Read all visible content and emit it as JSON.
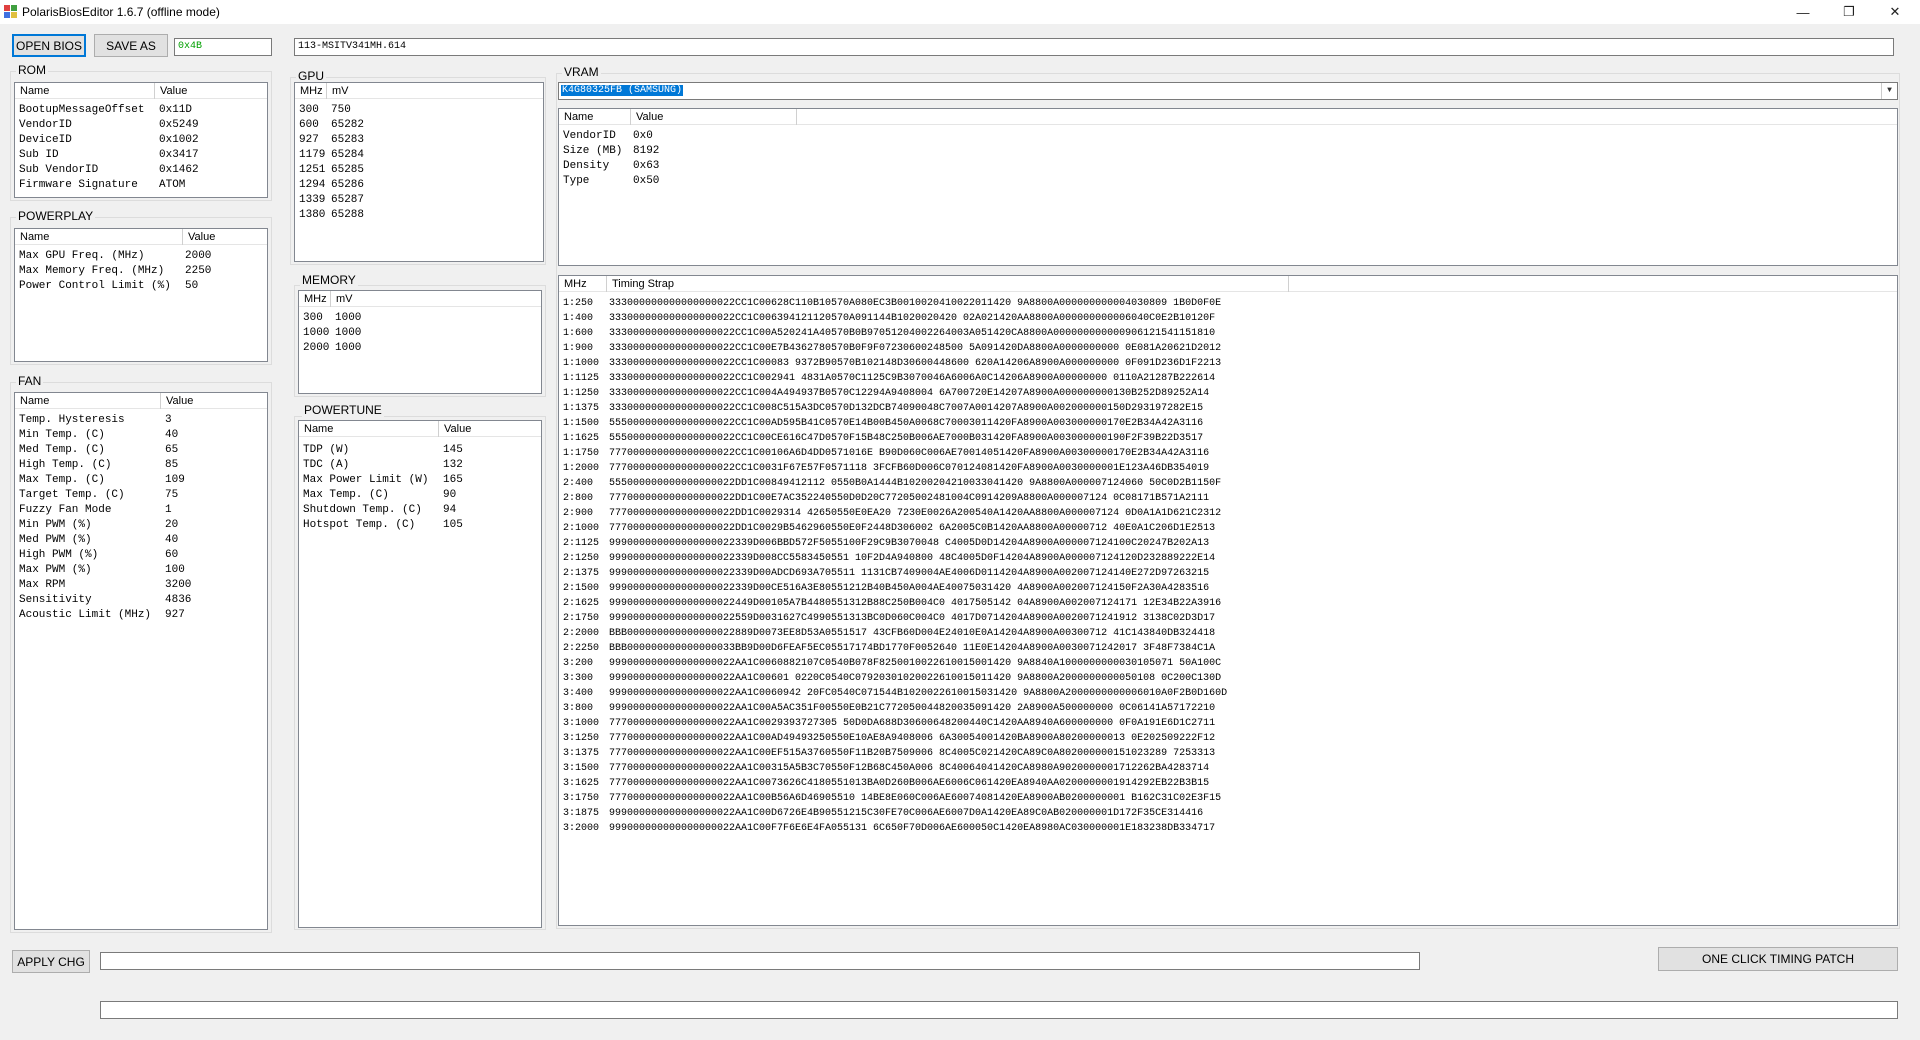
{
  "window": {
    "title": "PolarisBiosEditor 1.6.7 (offline mode)",
    "minimize_glyph": "—",
    "restore_glyph": "❐",
    "close_glyph": "✕"
  },
  "toolbar": {
    "open_label": "OPEN BIOS",
    "save_label": "SAVE AS",
    "checksum": "0x4B",
    "bios_name": "113-MSITV341MH.614"
  },
  "rom": {
    "label": "ROM",
    "headers": [
      "Name",
      "Value"
    ],
    "rows": [
      [
        "BootupMessageOffset",
        "0x11D"
      ],
      [
        "VendorID",
        "0x5249"
      ],
      [
        "DeviceID",
        "0x1002"
      ],
      [
        "Sub ID",
        "0x3417"
      ],
      [
        "Sub VendorID",
        "0x1462"
      ],
      [
        "Firmware Signature",
        "ATOM"
      ]
    ]
  },
  "powerplay": {
    "label": "POWERPLAY",
    "headers": [
      "Name",
      "Value"
    ],
    "rows": [
      [
        "Max GPU Freq. (MHz)",
        "2000"
      ],
      [
        "Max Memory Freq. (MHz)",
        "2250"
      ],
      [
        "Power Control Limit (%)",
        "50"
      ]
    ]
  },
  "fan": {
    "label": "FAN",
    "headers": [
      "Name",
      "Value"
    ],
    "rows": [
      [
        "Temp. Hysteresis",
        "3"
      ],
      [
        "Min Temp. (C)",
        "40"
      ],
      [
        "Med Temp. (C)",
        "65"
      ],
      [
        "High Temp. (C)",
        "85"
      ],
      [
        "Max Temp. (C)",
        "109"
      ],
      [
        "Target Temp. (C)",
        "75"
      ],
      [
        "Fuzzy Fan Mode",
        "1"
      ],
      [
        "Min PWM (%)",
        "20"
      ],
      [
        "Med PWM (%)",
        "40"
      ],
      [
        "High PWM (%)",
        "60"
      ],
      [
        "Max PWM (%)",
        "100"
      ],
      [
        "Max RPM",
        "3200"
      ],
      [
        "Sensitivity",
        "4836"
      ],
      [
        "Acoustic Limit (MHz)",
        "927"
      ]
    ]
  },
  "gpu": {
    "label": "GPU",
    "headers": [
      "MHz",
      "mV"
    ],
    "rows": [
      [
        "300",
        "750"
      ],
      [
        "600",
        "65282"
      ],
      [
        "927",
        "65283"
      ],
      [
        "1179",
        "65284"
      ],
      [
        "1251",
        "65285"
      ],
      [
        "1294",
        "65286"
      ],
      [
        "1339",
        "65287"
      ],
      [
        "1380",
        "65288"
      ]
    ]
  },
  "memory": {
    "label": "MEMORY",
    "headers": [
      "MHz",
      "mV"
    ],
    "rows": [
      [
        "300",
        "1000"
      ],
      [
        "1000",
        "1000"
      ],
      [
        "2000",
        "1000"
      ]
    ]
  },
  "powertune": {
    "label": "POWERTUNE",
    "headers": [
      "Name",
      "Value"
    ],
    "rows": [
      [
        "TDP (W)",
        "145"
      ],
      [
        "TDC (A)",
        "132"
      ],
      [
        "Max Power Limit (W)",
        "165"
      ],
      [
        "Max Temp. (C)",
        "90"
      ],
      [
        "Shutdown Temp. (C)",
        "94"
      ],
      [
        "Hotspot Temp. (C)",
        "105"
      ]
    ]
  },
  "vram": {
    "label": "VRAM",
    "selected": "K4G80325FB (SAMSUNG)",
    "headers": [
      "Name",
      "Value"
    ],
    "rows": [
      [
        "VendorID",
        "0x0"
      ],
      [
        "Size (MB)",
        "8192"
      ],
      [
        "Density",
        "0x63"
      ],
      [
        "Type",
        "0x50"
      ]
    ]
  },
  "timings": {
    "headers": [
      "MHz",
      "Timing Strap"
    ],
    "rows": [
      [
        "1:250",
        "333000000000000000022CC1C00628C110B10570A080EC3B0010020410022011420 9A8800A000000000004030809 1B0D0F0E"
      ],
      [
        "1:400",
        "333000000000000000022CC1C006394121120570A091144B1020020420 02A021420AA8800A000000000006040C0E2B10120F"
      ],
      [
        "1:600",
        "333000000000000000022CC1C00A520241A40570B0B97051204002264003A051420CA8800A000000000000906121541151810"
      ],
      [
        "1:900",
        "333000000000000000022CC1C00E7B4362780570B0F9F07230600248500 5A091420DA8800A0000000000 0E081A20621D2012"
      ],
      [
        "1:1000",
        "333000000000000000022CC1C00083 9372B90570B102148D30600448600 620A14206A8900A000000000 0F091D236D1F2213"
      ],
      [
        "1:1125",
        "333000000000000000022CC1C002941 4831A0570C1125C9B3070046A6006A0C14206A8900A00000000 0110A21287B222614"
      ],
      [
        "1:1250",
        "333000000000000000022CC1C004A494937B0570C12294A9408004 6A700720E14207A8900A000000000130B252D89252A14"
      ],
      [
        "1:1375",
        "333000000000000000022CC1C008C515A3DC0570D132DCB74090048C7007A0014207A8900A002000000150D293197282E15"
      ],
      [
        "1:1500",
        "555000000000000000022CC1C00AD595B41C0570E14B00B450A0068C70003011420FA8900A003000000170E2B34A42A3116"
      ],
      [
        "1:1625",
        "555000000000000000022CC1C00CE616C47D0570F15B48C250B006AE7000B031420FA8900A003000000190F2F39B22D3517"
      ],
      [
        "1:1750",
        "777000000000000000022CC1C00106A6D4DD0571016E B90D060C006AE70014051420FA8900A00300000170E2B34A42A3116"
      ],
      [
        "1:2000",
        "777000000000000000022CC1C0031F67E57F0571118 3FCFB60D006C070124081420FA8900A0030000001E123A46DB354019"
      ],
      [
        "2:400",
        "555000000000000000022DD1C00849412112 0550B0A1444B10200204210033041420 9A8800A000007124060 50C0D2B1150F"
      ],
      [
        "2:800",
        "777000000000000000022DD1C00E7AC352240550D0D20C77205002481004C0914209A8800A000007124 0C08171B571A2111"
      ],
      [
        "2:900",
        "777000000000000000022DD1C0029314 42650550E0EA20 7230E0026A200540A1420AA8800A000007124 0D0A1A1D621C2312"
      ],
      [
        "2:1000",
        "777000000000000000022DD1C0029B5462960550E0F2448D306002 6A2005C0B1420AA8800A00000712 40E0A1C206D1E2513"
      ],
      [
        "2:1125",
        "999000000000000000022339D006BBD572F5055100F29C9B3070048 C4005D0D14204A8900A000007124100C20247B202A13"
      ],
      [
        "2:1250",
        "999000000000000000022339D008CC5583450551 10F2D4A940800 48C4005D0F14204A8900A000007124120D232889222E14"
      ],
      [
        "2:1375",
        "999000000000000000022339D00ADCD693A705511 1131CB7409004AE4006D0114204A8900A002007124140E272D97263215"
      ],
      [
        "2:1500",
        "999000000000000000022339D00CE516A3E80551212B40B450A004AE40075031420 4A8900A002007124150F2A30A4283516"
      ],
      [
        "2:1625",
        "999000000000000000022449D00105A7B4480551312B88C250B004C0 4017505142 04A8900A002007124171 12E34B22A3916"
      ],
      [
        "2:1750",
        "999000000000000000022559D0031627C4990551313BC0D060C004C0 4017D0714204A8900A0020071241912 3138C02D3D17"
      ],
      [
        "2:2000",
        "BBB000000000000000022889D0073EE8D53A0551517 43CFB60D004E24010E0A14204A8900A00300712 41C143840DB324418"
      ],
      [
        "2:2250",
        "BBB000000000000000033BB9D00D6FEAF5EC05517174BD1770F0052640 11E0E14204A8900A0030071242017 3F48F7384C1A"
      ],
      [
        "3:200",
        "999000000000000000022AA1C0060882107C0540B078F8250010022610015001420 9A8840A1000000000030105071 50A100C"
      ],
      [
        "3:300",
        "999000000000000000022AA1C00601 0220C0540C07920301020022610015011420 9A8800A2000000000050108 0C200C130D"
      ],
      [
        "3:400",
        "999000000000000000022AA1C0060942 20FC0540C071544B1020022610015031420 9A8800A2000000000006010A0F2B0D160D"
      ],
      [
        "3:800",
        "999000000000000000022AA1C00A5AC351F00550E0B21C772050044820035091420 2A8900A500000000 0C06141A57172210"
      ],
      [
        "3:1000",
        "777000000000000000022AA1C0029393727305 50D0DA688D30600648200440C1420AA8940A600000000 0F0A191E6D1C2711"
      ],
      [
        "3:1250",
        "777000000000000000022AA1C00AD49493250550E10AE8A9408006 6A30054001420BA8900A80200000013 0E202509222F12"
      ],
      [
        "3:1375",
        "777000000000000000022AA1C00EF515A3760550F11B20B7509006 8C4005C021420CA89C0A802000000151023289 7253313"
      ],
      [
        "3:1500",
        "777000000000000000022AA1C00315A5B3C70550F12B68C450A006 8C40064041420CA8980A9020000001712262BA4283714"
      ],
      [
        "3:1625",
        "777000000000000000022AA1C0073626C4180551013BA0D260B006AE6006C061420EA8940AA0200000001914292EB22B3B15"
      ],
      [
        "3:1750",
        "777000000000000000022AA1C00B56A6D46905510 14BE8E060C006AE60074081420EA8900AB0200000001 B162C31C02E3F15"
      ],
      [
        "3:1875",
        "999000000000000000022AA1C00D6726E4B90551215C30FE70C006AE6007D0A1420EA89C0AB020000001D172F35CE314416"
      ],
      [
        "3:2000",
        "999000000000000000022AA1C00F7F6E6E4FA055131 6C650F70D006AE600050C1420EA8980AC030000001E183238DB334717"
      ]
    ]
  },
  "footer": {
    "apply_label": "APPLY CHG",
    "patch_label": "ONE CLICK TIMING PATCH"
  },
  "colors": {
    "accent": "#0078d7",
    "checksum_text": "#00a000",
    "window_bg": "#f0f0f0"
  }
}
